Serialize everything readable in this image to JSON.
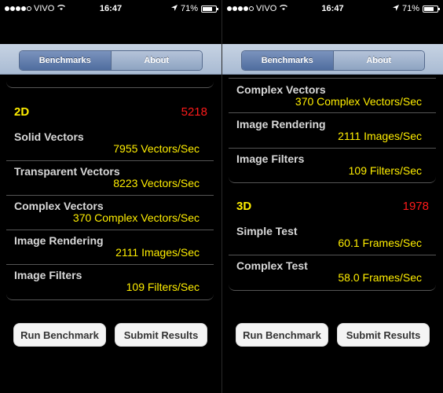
{
  "screens": [
    {
      "status": {
        "carrier": "VIVO",
        "time": "16:47",
        "battery": "71%"
      },
      "tabs": [
        "Benchmarks",
        "About"
      ],
      "sections": [
        {
          "name": "2D",
          "score": "5218",
          "rows": [
            {
              "label": "Solid Vectors",
              "value": "7955 Vectors/Sec"
            },
            {
              "label": "Transparent Vectors",
              "value": "8223 Vectors/Sec"
            },
            {
              "label": "Complex Vectors",
              "value": "370 Complex Vectors/Sec"
            },
            {
              "label": "Image Rendering",
              "value": "2111 Images/Sec"
            },
            {
              "label": "Image Filters",
              "value": "109 Filters/Sec"
            }
          ]
        }
      ],
      "buttons": {
        "run": "Run Benchmark",
        "submit": "Submit Results"
      }
    },
    {
      "status": {
        "carrier": "VIVO",
        "time": "16:47",
        "battery": "71%"
      },
      "tabs": [
        "Benchmarks",
        "About"
      ],
      "top_rows": [
        {
          "label": "Complex Vectors",
          "value": "370 Complex Vectors/Sec"
        },
        {
          "label": "Image Rendering",
          "value": "2111 Images/Sec"
        },
        {
          "label": "Image Filters",
          "value": "109 Filters/Sec"
        }
      ],
      "sections": [
        {
          "name": "3D",
          "score": "1978",
          "rows": [
            {
              "label": "Simple Test",
              "value": "60.1 Frames/Sec"
            },
            {
              "label": "Complex Test",
              "value": "58.0 Frames/Sec"
            }
          ]
        }
      ],
      "buttons": {
        "run": "Run Benchmark",
        "submit": "Submit Results"
      }
    }
  ],
  "colors": {
    "accent_yellow": "#ffee00",
    "score_red": "#ff1a1a",
    "nav_blue": "#4f6d9f"
  }
}
